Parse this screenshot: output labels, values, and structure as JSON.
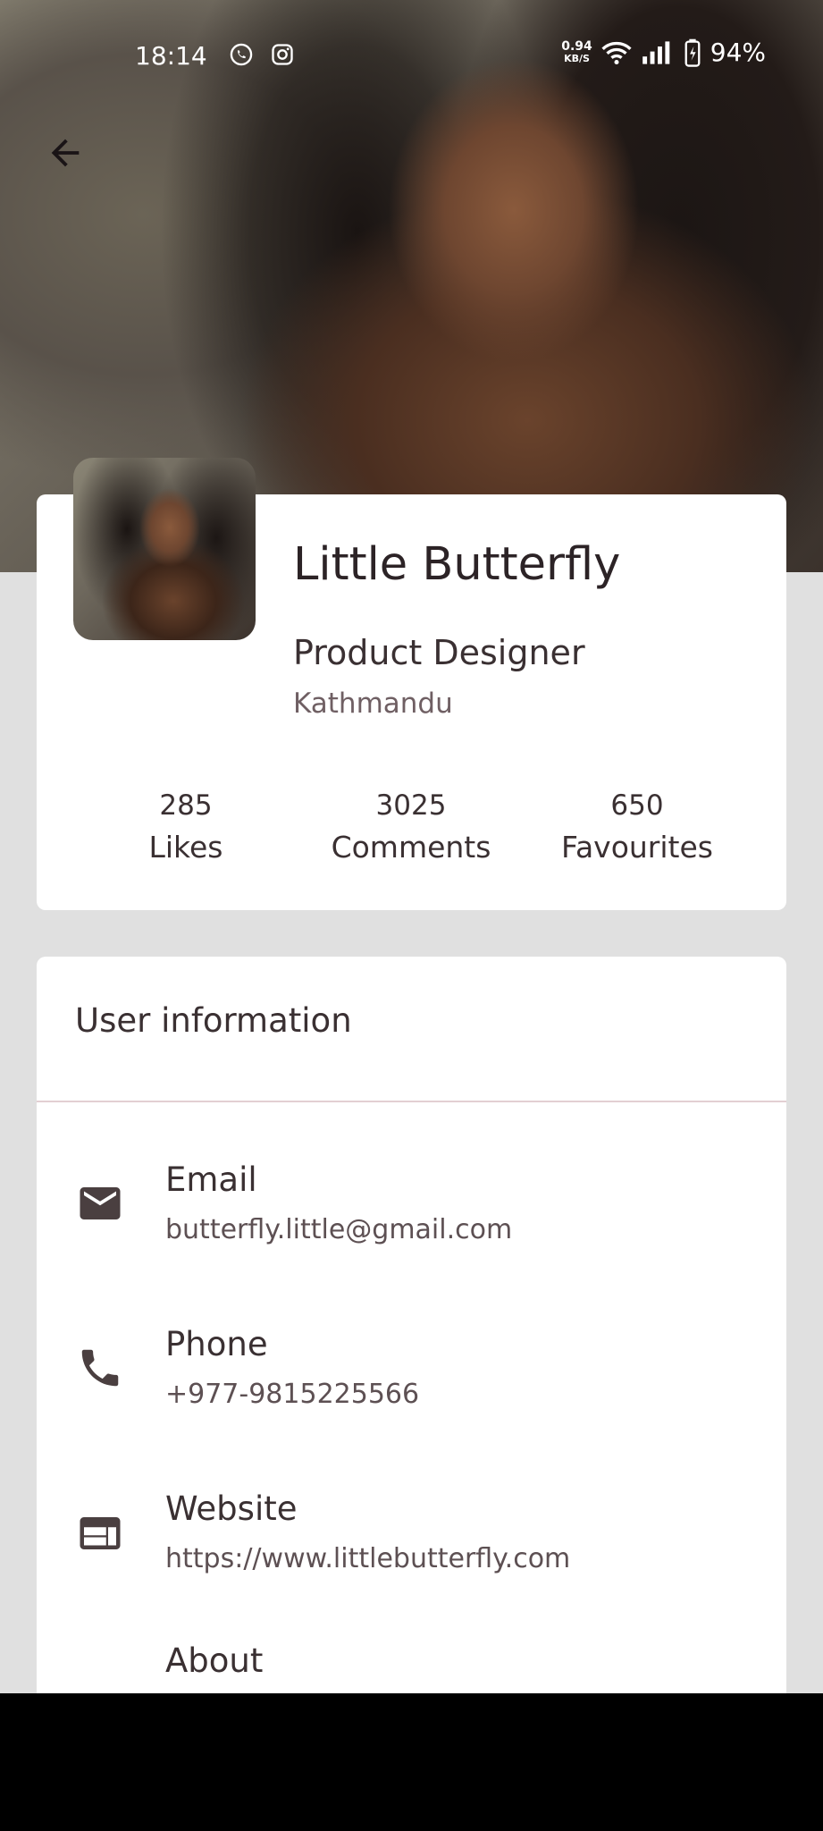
{
  "status_bar": {
    "time": "18:14",
    "app_icons": [
      "whatsapp-icon",
      "instagram-icon"
    ],
    "net_speed_value": "0.94",
    "net_speed_unit": "KB/S",
    "battery": "94%"
  },
  "profile": {
    "name": "Little Butterfly",
    "title": "Product Designer",
    "location": "Kathmandu",
    "stats": [
      {
        "value": "285",
        "label": "Likes"
      },
      {
        "value": "3025",
        "label": "Comments"
      },
      {
        "value": "650",
        "label": "Favourites"
      }
    ]
  },
  "info": {
    "heading": "User information",
    "rows": [
      {
        "icon": "email-icon",
        "title": "Email",
        "value": "butterfly.little@gmail.com"
      },
      {
        "icon": "phone-icon",
        "title": "Phone",
        "value": "+977-9815225566"
      },
      {
        "icon": "web-icon",
        "title": "Website",
        "value": "https://www.littlebutterfly.com"
      },
      {
        "title": "About"
      }
    ]
  },
  "colors": {
    "background": "#e0e0e0",
    "card": "#ffffff",
    "text_primary": "#2c2326",
    "text_secondary": "#6f5f63",
    "icon": "#4a3f40",
    "divider": "#e3cfd3"
  }
}
